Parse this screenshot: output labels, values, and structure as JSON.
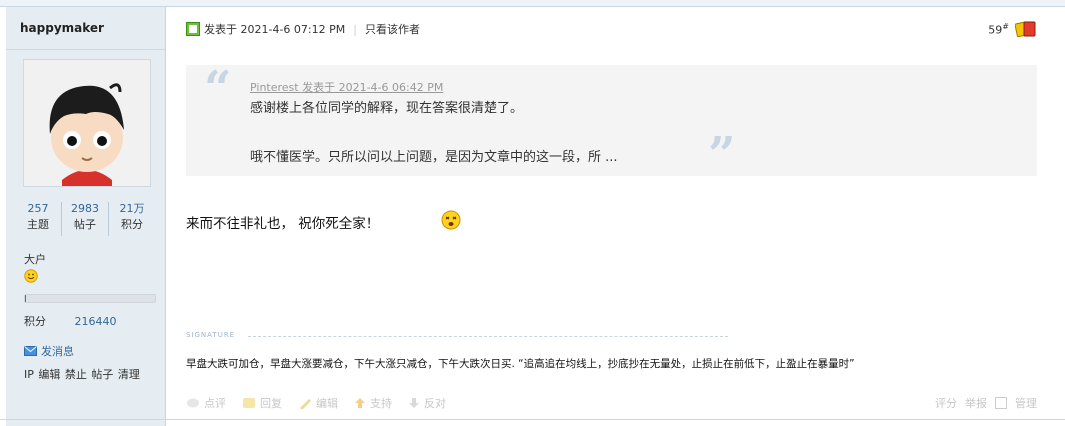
{
  "author": {
    "name": "happymaker",
    "stats": [
      {
        "num": "257",
        "label": "主题"
      },
      {
        "num": "2983",
        "label": "帖子"
      },
      {
        "num": "21万",
        "label": "积分"
      }
    ],
    "rank": "大户",
    "progress_fraction": 0.01,
    "score_label": "积分",
    "score_value": "216440",
    "message_link": "发消息",
    "admin_ops": "IP 编辑 禁止 帖子 清理"
  },
  "post": {
    "posted_at": "发表于 2021-4-6 07:12 PM",
    "only_author": "只看该作者",
    "floor": "59",
    "floor_suffix": "#",
    "quote": {
      "meta": "Pinterest 发表于 2021-4-6 06:42 PM",
      "line1": "感谢楼上各位同学的解释，现在答案很清楚了。",
      "line2": "哦不懂医学。只所以问以上问题，是因为文章中的这一段，所 ..."
    },
    "content": "来而不往非礼也，   祝你死全家！",
    "signature_label": "SIGNATURE",
    "signature": "早盘大跌可加仓，早盘大涨要减仓，下午大涨只减仓，下午大跌次日买. “追高追在均线上，抄底抄在无量处，止损止在前低下，止盈止在暴量时”",
    "actions": [
      "点评",
      "回复",
      "编辑",
      "支持",
      "反对"
    ],
    "right_actions": [
      "评分",
      "举报",
      "管理"
    ]
  },
  "colors": {
    "accent": "#336699",
    "sidebar_bg": "#e5edf2",
    "quote_bg": "#f4f4f4"
  }
}
